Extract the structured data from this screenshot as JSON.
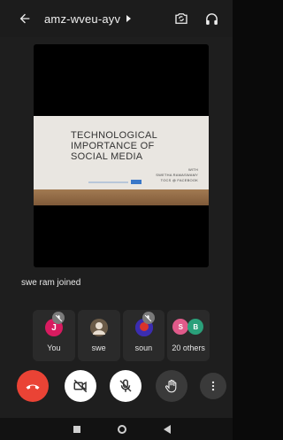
{
  "topbar": {
    "meeting_code": "amz-wveu-ayv"
  },
  "slide": {
    "title_line1": "TECHNOLOGICAL",
    "title_line2": "IMPORTANCE OF",
    "title_line3": "SOCIAL MEDIA",
    "sub_line1": "WITH",
    "sub_line2": "SWETHA RAMASWAMY",
    "sub_line3": "TOCS @ FACEBOOK"
  },
  "toast": "swe ram joined",
  "participants": [
    {
      "name": "You",
      "initial": "J",
      "avatar_color": "#d81b60",
      "muted": true
    },
    {
      "name": "swe",
      "initial": "",
      "avatar_color": "#5a4a3a",
      "muted": false
    },
    {
      "name": "soun",
      "initial": "",
      "avatar_color": "#3b2db0",
      "muted": true
    }
  ],
  "others": {
    "label": "20 others",
    "a_initial": "S",
    "a_color": "#e05a8a",
    "b_initial": "B",
    "b_color": "#2aa07a"
  },
  "colors": {
    "end_call": "#ea4335",
    "background": "#1e1e1e"
  }
}
